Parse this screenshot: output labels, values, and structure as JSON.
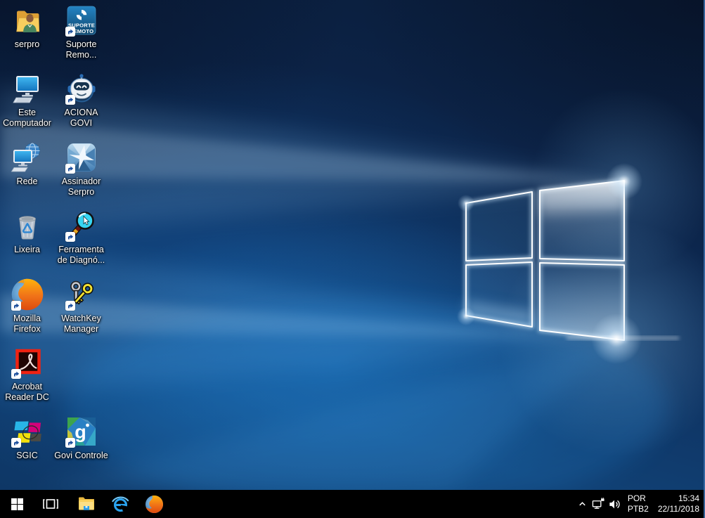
{
  "desktop": {
    "icons": [
      {
        "id": "serpro",
        "icon": "folder-user-icon",
        "label": "serpro",
        "lines": [
          "serpro"
        ],
        "shortcut": false
      },
      {
        "id": "suporte-remoto",
        "icon": "suporte-remoto-tile-icon",
        "label": "Suporte Remo...",
        "lines": [
          "Suporte",
          "Remo..."
        ],
        "shortcut": true,
        "tile_lines": [
          "SUPORTE",
          "REMOTO"
        ]
      },
      {
        "id": "este-computador",
        "icon": "this-pc-icon",
        "label": "Este Computador",
        "lines": [
          "Este",
          "Computador"
        ],
        "shortcut": false
      },
      {
        "id": "aciona-govi",
        "icon": "robot-icon",
        "label": "ACIONA GOVI",
        "lines": [
          "ACIONA",
          "GOVI"
        ],
        "shortcut": true
      },
      {
        "id": "rede",
        "icon": "network-globe-icon",
        "label": "Rede",
        "lines": [
          "Rede"
        ],
        "shortcut": false
      },
      {
        "id": "assinador-serpro",
        "icon": "diamond-gem-icon",
        "label": "Assinador Serpro",
        "lines": [
          "Assinador",
          "Serpro"
        ],
        "shortcut": true
      },
      {
        "id": "lixeira",
        "icon": "recycle-bin-icon",
        "label": "Lixeira",
        "lines": [
          "Lixeira"
        ],
        "shortcut": false
      },
      {
        "id": "ferramenta-diagnostico",
        "icon": "magnifier-diagnostic-icon",
        "label": "Ferramenta de Diagnó...",
        "lines": [
          "Ferramenta",
          "de Diagnó..."
        ],
        "shortcut": true
      },
      {
        "id": "mozilla-firefox",
        "icon": "firefox-icon",
        "label": "Mozilla Firefox",
        "lines": [
          "Mozilla",
          "Firefox"
        ],
        "shortcut": true
      },
      {
        "id": "watchkey-manager",
        "icon": "keys-icon",
        "label": "WatchKey Manager",
        "lines": [
          "WatchKey",
          "Manager"
        ],
        "shortcut": true
      },
      {
        "id": "acrobat-reader",
        "icon": "acrobat-reader-icon",
        "label": "Acrobat Reader DC",
        "lines": [
          "Acrobat",
          "Reader DC"
        ],
        "shortcut": true
      },
      {
        "id": "sgic",
        "icon": "cmyk-shapes-icon",
        "label": "SGIC",
        "lines": [
          "SGIC"
        ],
        "shortcut": true
      },
      {
        "id": "govi-controle",
        "icon": "govi-tile-icon",
        "label": "Govi Controle",
        "lines": [
          "Govi Controle"
        ],
        "shortcut": true,
        "tile_letter": "g"
      }
    ]
  },
  "taskbar": {
    "button_icons": [
      "windows-logo-icon",
      "task-view-icon",
      "file-explorer-folder-icon",
      "internet-explorer-icon",
      "firefox-icon"
    ],
    "tray_icons": [
      "chevron-up-icon",
      "ethernet-network-icon",
      "volume-speaker-icon"
    ],
    "tray": {
      "language": {
        "line1": "POR",
        "line2": "PTB2"
      },
      "clock": {
        "time": "15:34",
        "date": "22/11/2018"
      }
    }
  },
  "colors": {
    "taskbar_bg": "#000000",
    "wallpaper_deep_blue": "#0a1c38",
    "wallpaper_glow_blue": "#1d7fd0",
    "tray_text": "#ffffff"
  }
}
